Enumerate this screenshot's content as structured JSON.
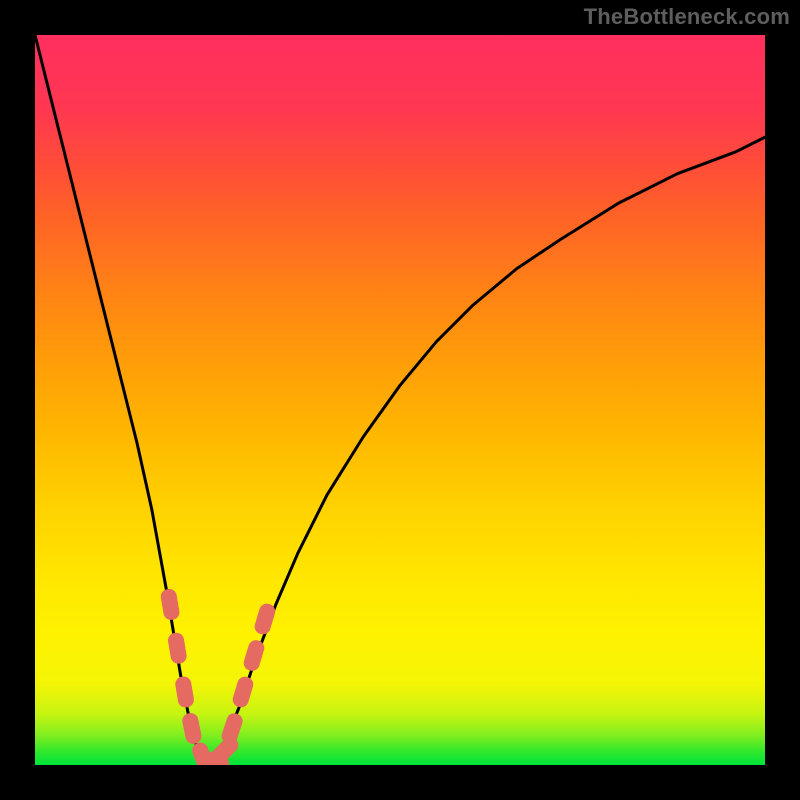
{
  "watermark": "TheBottleneck.com",
  "colors": {
    "frame": "#000000",
    "curve_stroke": "#000000",
    "marker_fill": "#e46a62",
    "marker_stroke": "#e46a62"
  },
  "chart_data": {
    "type": "line",
    "title": "",
    "xlabel": "",
    "ylabel": "",
    "xlim": [
      0,
      100
    ],
    "ylim": [
      0,
      100
    ],
    "grid": false,
    "legend": false,
    "series": [
      {
        "name": "bottleneck-curve",
        "x": [
          0,
          2,
          4,
          6,
          8,
          10,
          12,
          14,
          16,
          18,
          19,
          20,
          21,
          22,
          23,
          24,
          25,
          26,
          28,
          30,
          33,
          36,
          40,
          45,
          50,
          55,
          60,
          66,
          72,
          80,
          88,
          96,
          100
        ],
        "y": [
          100,
          92,
          84,
          76,
          68,
          60,
          52,
          44,
          35,
          24,
          18,
          12,
          7,
          3,
          1,
          0.5,
          1,
          3,
          8,
          14,
          22,
          29,
          37,
          45,
          52,
          58,
          63,
          68,
          72,
          77,
          81,
          84,
          86
        ]
      }
    ],
    "markers": [
      {
        "x": 18.5,
        "y": 22
      },
      {
        "x": 19.5,
        "y": 16
      },
      {
        "x": 20.5,
        "y": 10
      },
      {
        "x": 21.5,
        "y": 5
      },
      {
        "x": 23.0,
        "y": 1
      },
      {
        "x": 24.5,
        "y": 0.5
      },
      {
        "x": 26.0,
        "y": 2
      },
      {
        "x": 27.0,
        "y": 5
      },
      {
        "x": 28.5,
        "y": 10
      },
      {
        "x": 30.0,
        "y": 15
      },
      {
        "x": 31.5,
        "y": 20
      }
    ]
  }
}
